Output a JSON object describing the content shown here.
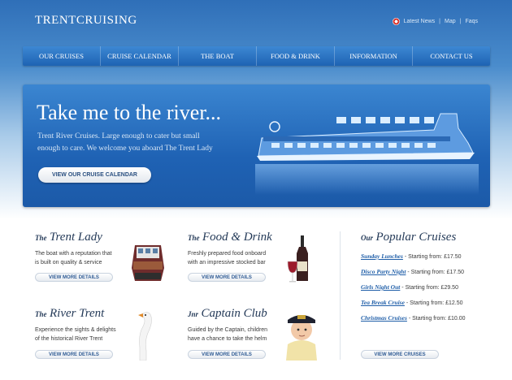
{
  "header": {
    "logo": "TRENTCRUISING",
    "links": [
      "Latest News",
      "Map",
      "Faqs"
    ],
    "separator": "|"
  },
  "nav": [
    "OUR CRUISES",
    "CRUISE CALENDAR",
    "THE BOAT",
    "FOOD & DRINK",
    "INFORMATION",
    "CONTACT US"
  ],
  "hero": {
    "title": "Take me to the river...",
    "text_line1": "Trent River Cruises. Large enough to cater but small",
    "text_line2": "enough to care. We welcome you aboard The Trent Lady",
    "button": "VIEW OUR CRUISE CALENDAR"
  },
  "sections": [
    {
      "pre": "The",
      "title": "Trent Lady",
      "line1": "The boat with a reputation that",
      "line2": "is built on quality & service",
      "button": "VIEW MORE DETAILS"
    },
    {
      "pre": "The",
      "title": "Food & Drink",
      "line1": "Freshly prepared food onboard",
      "line2": "with an impressive stocked bar",
      "button": "VIEW MORE DETAILS"
    },
    {
      "pre": "The",
      "title": "River Trent",
      "line1": "Experience the sights & delights",
      "line2": "of the historical River Trent",
      "button": "VIEW MORE DETAILS"
    },
    {
      "pre": "Jnr",
      "title": "Captain Club",
      "line1": "Guided by the Captain, children",
      "line2": "have a chance to take the helm",
      "button": "VIEW MORE DETAILS"
    }
  ],
  "popular": {
    "pre": "Our",
    "title": "Popular Cruises",
    "price_prefix": " - Starting from: ",
    "items": [
      {
        "name": "Sunday Lunches",
        "price": "£17.50"
      },
      {
        "name": "Disco Party Night",
        "price": "£17.50"
      },
      {
        "name": "Girls Night Out",
        "price": "£29.50"
      },
      {
        "name": "Tea Break Cruise",
        "price": "£12.50"
      },
      {
        "name": "Christmas Cruises",
        "price": "£10.00"
      }
    ],
    "button": "VIEW MORE CRUISES"
  }
}
